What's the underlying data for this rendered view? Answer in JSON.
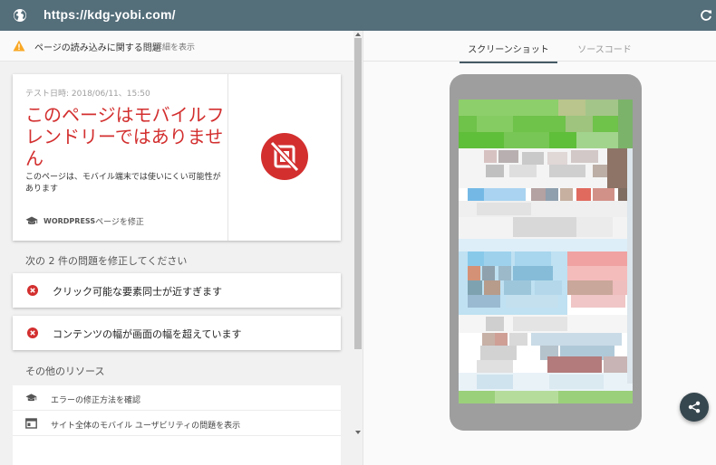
{
  "address_bar": {
    "url": "https://kdg-yobi.com/",
    "globe_icon": "globe-icon",
    "reload_icon": "reload-icon"
  },
  "load_issue": {
    "text": "ページの読み込みに関する問題",
    "details_link": "詳細を表示",
    "icon": "warning-icon"
  },
  "result": {
    "test_datetime": "テスト日時: 2018/06/11、15:50",
    "title": "このページはモバイルフレンドリーではありません",
    "description": "このページは、モバイル端末では使いにくい可能性があります",
    "wordpress_label": "WORDPRESS",
    "wordpress_suffix": " ページを修正",
    "icon": "mobile-unfriendly-icon",
    "colors": {
      "error": "#d32f2f"
    }
  },
  "issues": {
    "heading": "次の 2 件の問題を修正してください",
    "items": [
      {
        "text": "クリック可能な要素同士が近すぎます"
      },
      {
        "text": "コンテンツの幅が画面の幅を超えています"
      }
    ]
  },
  "resources": {
    "heading": "その他のリソース",
    "items": [
      {
        "text": "エラーの修正方法を確認",
        "icon": "graduation-cap-icon"
      },
      {
        "text": "サイト全体のモバイル ユーザビリティの問題を表示",
        "icon": "browser-window-icon"
      }
    ]
  },
  "tabs": {
    "screenshot": "スクリーンショット",
    "source": "ソースコード",
    "active": "screenshot"
  },
  "share_icon": "share-icon"
}
